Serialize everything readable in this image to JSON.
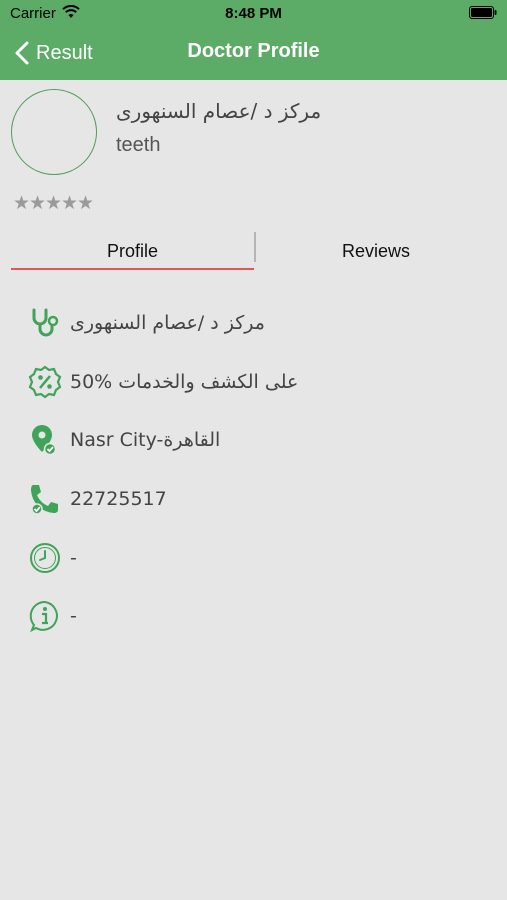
{
  "status_bar": {
    "carrier": "Carrier",
    "time": "8:48 PM"
  },
  "nav": {
    "back_label": "Result",
    "title": "Doctor Profile"
  },
  "doctor": {
    "name": "مركز د /عصام السنهورى",
    "specialty": "teeth",
    "rating": {
      "value": 0,
      "max": 5,
      "star_glyph": "★"
    }
  },
  "tabs": [
    {
      "label": "Profile",
      "selected": true
    },
    {
      "label": "Reviews",
      "selected": false
    }
  ],
  "info": [
    {
      "icon": "stethoscope-icon",
      "text": "مركز د /عصام السنهورى"
    },
    {
      "icon": "discount-badge-icon",
      "text": "50% على الكشف والخدمات"
    },
    {
      "icon": "location-pin-icon",
      "text": "Nasr City-القاهرة"
    },
    {
      "icon": "phone-icon",
      "text": "22725517"
    },
    {
      "icon": "clock-icon",
      "text": "-"
    },
    {
      "icon": "info-icon",
      "text": "-"
    }
  ],
  "colors": {
    "header_green": "#5cab67",
    "icon_green": "#3fa35a",
    "tab_underline": "#e5545a",
    "background": "#e6e6e6",
    "star_gray": "#9a9a9a"
  }
}
